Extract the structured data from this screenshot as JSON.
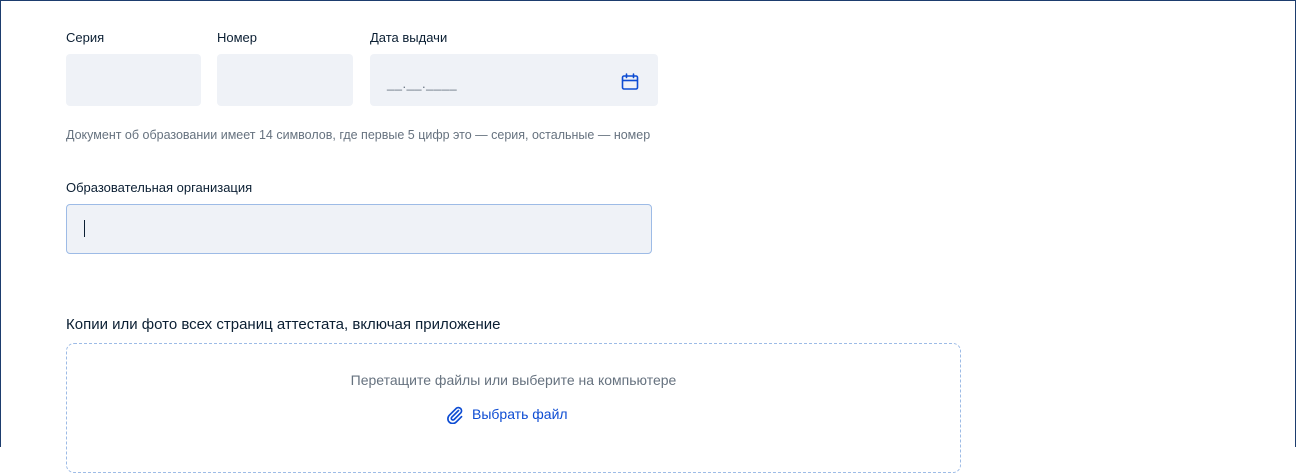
{
  "fields": {
    "series_label": "Серия",
    "number_label": "Номер",
    "issue_date_label": "Дата выдачи",
    "issue_date_mask": "__.__.____",
    "hint": "Документ об образовании имеет 14 символов, где первые 5 цифр это — серия, остальные — номер",
    "organization_label": "Образовательная организация",
    "organization_value": ""
  },
  "upload": {
    "title": "Копии или фото всех страниц аттестата, включая приложение",
    "drop_text": "Перетащите файлы или выберите на компьютере",
    "choose_file_label": "Выбрать файл"
  },
  "icons": {
    "date": "calendar-icon",
    "attach": "paperclip-icon"
  },
  "colors": {
    "accent": "#0d4cd3",
    "field_bg": "#eff2f7",
    "focus_border": "#9dbbe6",
    "muted_text": "#66727f"
  }
}
